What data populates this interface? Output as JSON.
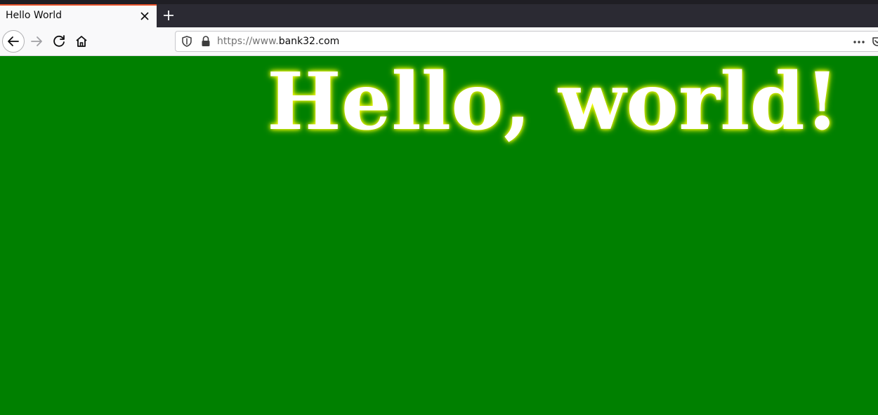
{
  "browser": {
    "tab": {
      "title": "Hello World"
    },
    "urlbar": {
      "scheme_prefix": "https://www.",
      "host": "bank32.com"
    },
    "icons": {
      "back": "back-arrow-icon",
      "forward": "forward-arrow-icon",
      "reload": "reload-icon",
      "home": "home-icon",
      "shield": "tracking-protection-shield-icon",
      "lock": "lock-icon",
      "page_actions": "more-horizontal-icon",
      "pocket": "pocket-icon",
      "close_tab": "close-icon",
      "new_tab": "plus-icon"
    }
  },
  "page": {
    "background_color": "#008000",
    "headline": "Hello, world!",
    "headline_color": "#ffffff",
    "headline_glow_color": "#ffff00"
  }
}
